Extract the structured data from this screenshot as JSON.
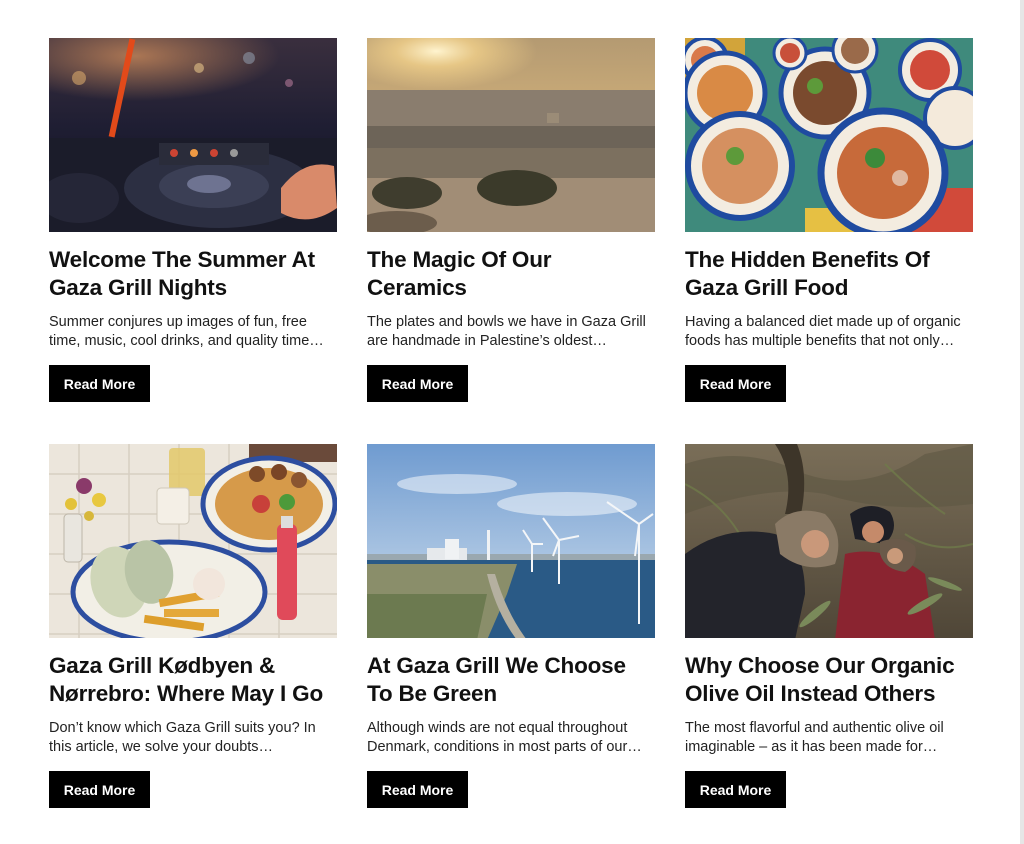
{
  "articles": [
    {
      "title": "Welcome The Summer At Gaza Grill Nights",
      "excerpt": "Summer conjures up images of fun, free time, music, cool drinks, and quality time…",
      "button": "Read More",
      "image": "dj-turntable-photo"
    },
    {
      "title": "The Magic Of Our Ceramics",
      "excerpt": "The plates and bowls we have in Gaza Grill are handmade in Palestine’s oldest…",
      "button": "Read More",
      "image": "jerusalem-sunset-photo"
    },
    {
      "title": "The Hidden Benefits Of Gaza Grill Food",
      "excerpt": "Having a balanced diet made up of organic foods has multiple benefits that not only…",
      "button": "Read More",
      "image": "food-bowls-photo"
    },
    {
      "title": "Gaza Grill Kødbyen & Nørrebro: Where May I Go",
      "excerpt": "Don’t know which Gaza Grill suits you? In this article, we solve your doubts…",
      "button": "Read More",
      "image": "falafel-plate-photo"
    },
    {
      "title": "At Gaza Grill We Choose To Be Green",
      "excerpt": "Although winds are not equal throughout Denmark, conditions in most parts of our…",
      "button": "Read More",
      "image": "wind-turbines-photo"
    },
    {
      "title": "Why Choose Our Organic Olive Oil Instead Others",
      "excerpt": "The most flavorful and authentic olive oil imaginable – as it has been made for…",
      "button": "Read More",
      "image": "olive-harvest-photo"
    }
  ],
  "colors": {
    "button_bg": "#000000",
    "button_text": "#ffffff",
    "title_text": "#111111"
  }
}
